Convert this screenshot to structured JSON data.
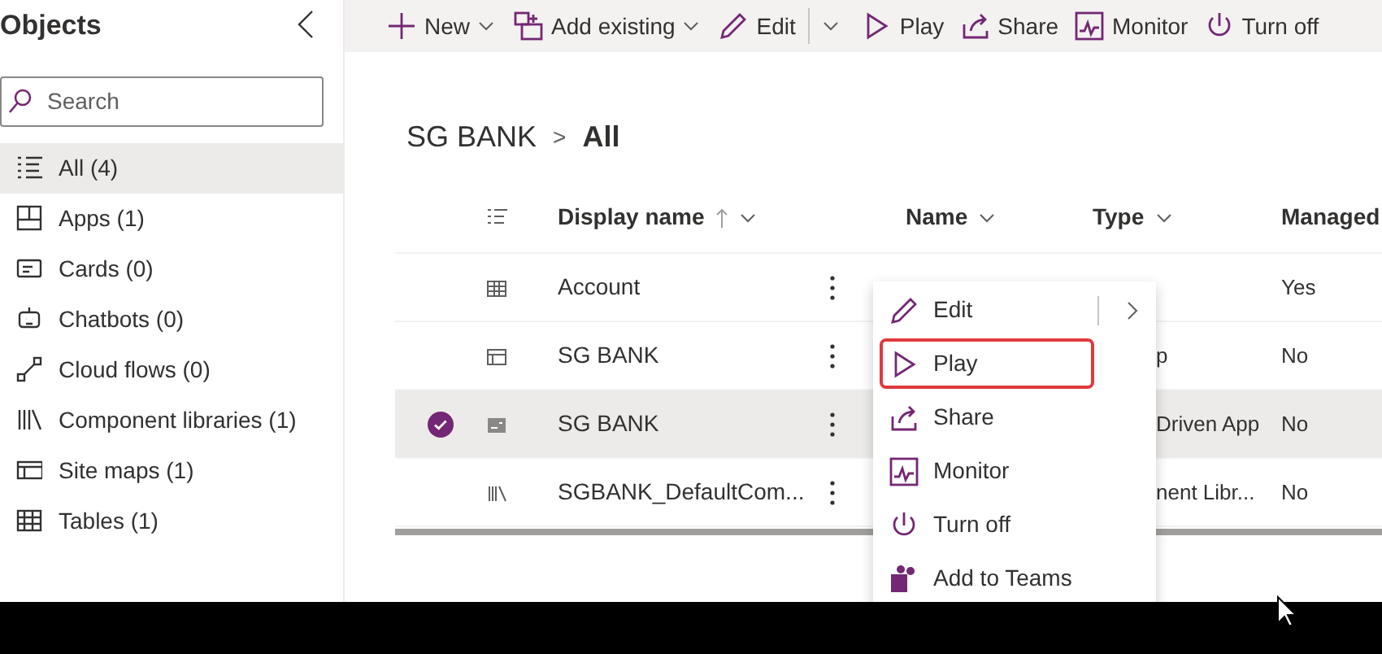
{
  "sidebar": {
    "title": "Objects",
    "search": {
      "placeholder": "Search"
    },
    "items": [
      {
        "label": "All (4)",
        "selected": true
      },
      {
        "label": "Apps (1)",
        "selected": false
      },
      {
        "label": "Cards (0)",
        "selected": false
      },
      {
        "label": "Chatbots (0)",
        "selected": false
      },
      {
        "label": "Cloud flows (0)",
        "selected": false
      },
      {
        "label": "Component libraries (1)",
        "selected": false
      },
      {
        "label": "Site maps (1)",
        "selected": false
      },
      {
        "label": "Tables (1)",
        "selected": false
      }
    ]
  },
  "toolbar": [
    {
      "label": "New",
      "kind": "dropdown"
    },
    {
      "label": "Add existing",
      "kind": "dropdown"
    },
    {
      "label": "Edit",
      "kind": "split"
    },
    {
      "label": "Play",
      "kind": "plain"
    },
    {
      "label": "Share",
      "kind": "plain"
    },
    {
      "label": "Monitor",
      "kind": "plain"
    },
    {
      "label": "Turn off",
      "kind": "plain"
    }
  ],
  "breadcrumb": {
    "parent": "SG BANK",
    "separator": ">",
    "current": "All"
  },
  "table": {
    "columns": [
      {
        "label": "Display name",
        "sorted": true
      },
      {
        "label": "Name",
        "sorted": false
      },
      {
        "label": "Type",
        "sorted": false
      },
      {
        "label": "Managed",
        "sorted": false
      }
    ],
    "rows": [
      {
        "display_name": "Account",
        "managed": "Yes",
        "selected": false
      },
      {
        "display_name": "SG BANK",
        "type": "p",
        "managed": "No",
        "selected": false
      },
      {
        "display_name": "SG BANK",
        "type": "Driven App",
        "managed": "No",
        "selected": true
      },
      {
        "display_name": "SGBANK_DefaultCom...",
        "type": "nent Libr...",
        "managed": "No",
        "selected": false
      }
    ]
  },
  "context_menu": [
    {
      "label": "Edit",
      "submenu": true,
      "highlighted": false
    },
    {
      "label": "Play",
      "submenu": false,
      "highlighted": true
    },
    {
      "label": "Share",
      "submenu": false,
      "highlighted": false
    },
    {
      "label": "Monitor",
      "submenu": false,
      "highlighted": false
    },
    {
      "label": "Turn off",
      "submenu": false,
      "highlighted": false
    },
    {
      "label": "Add to Teams",
      "submenu": false,
      "highlighted": false
    }
  ]
}
